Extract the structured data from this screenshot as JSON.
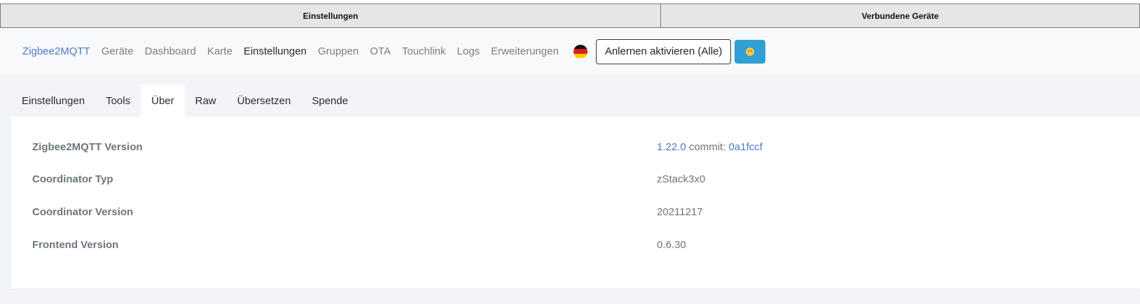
{
  "window_tabs": [
    "Einstellungen",
    "Verbundene Geräte"
  ],
  "navbar": {
    "brand": "Zigbee2MQTT",
    "links": [
      "Geräte",
      "Dashboard",
      "Karte",
      "Einstellungen",
      "Gruppen",
      "OTA",
      "Touchlink",
      "Logs",
      "Erweiterungen"
    ],
    "active_link": "Einstellungen",
    "language_flag": "german-flag-icon",
    "permit_join_label": "Anlernen aktivieren (Alle)",
    "theme_icon": "smiley-icon",
    "colors": {
      "brand": "#4f79c4",
      "theme_button": "#2f9fd4"
    }
  },
  "subtabs": {
    "items": [
      "Einstellungen",
      "Tools",
      "Über",
      "Raw",
      "Übersetzen",
      "Spende"
    ],
    "active": "Über"
  },
  "about": {
    "rows": [
      {
        "label": "Zigbee2MQTT Version",
        "version": "1.22.0",
        "commit_label": "commit:",
        "commit": "0a1fccf"
      },
      {
        "label": "Coordinator Typ",
        "value": "zStack3x0"
      },
      {
        "label": "Coordinator Version",
        "value": "20211217"
      },
      {
        "label": "Frontend Version",
        "value": "0.6.30"
      }
    ]
  }
}
